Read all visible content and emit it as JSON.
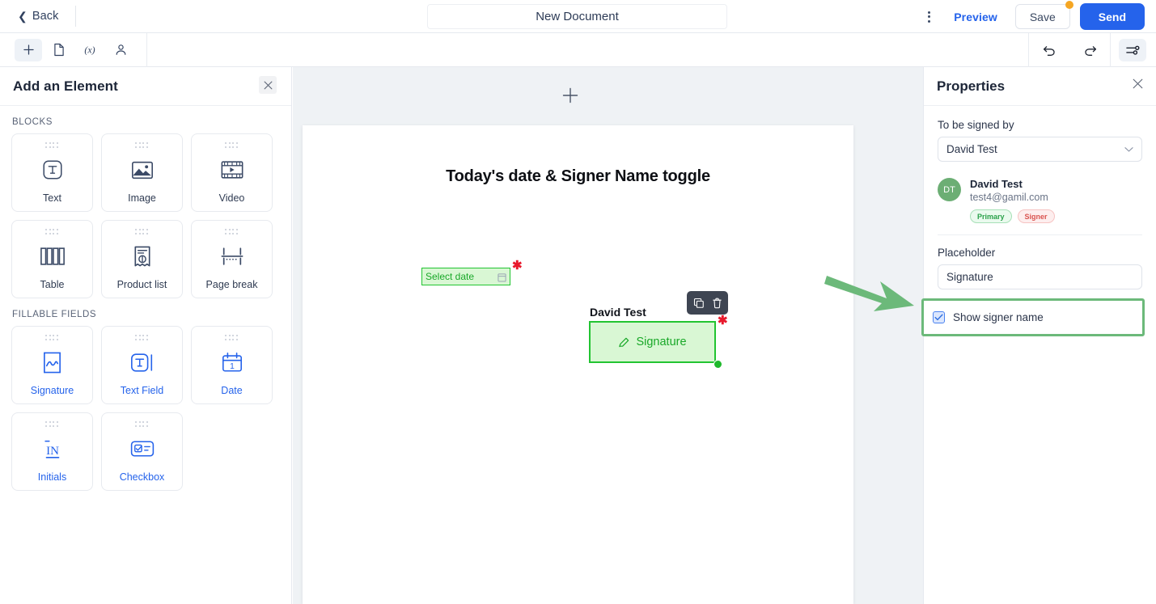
{
  "header": {
    "back_label": "Back",
    "document_title": "New Document",
    "document_title_placeholder": "Document name",
    "kebab_icon": "more-vertical-icon",
    "preview_label": "Preview",
    "save_label": "Save",
    "send_label": "Send",
    "save_badge": true
  },
  "toolbar": {
    "tools": [
      {
        "name": "add-element",
        "icon": "plus-icon",
        "active": true
      },
      {
        "name": "pages",
        "icon": "document-icon",
        "active": false
      },
      {
        "name": "variables",
        "icon": "variable-icon",
        "active": false
      },
      {
        "name": "recipients",
        "icon": "person-icon",
        "active": false
      }
    ],
    "undo_icon": "undo-icon",
    "redo_icon": "redo-icon",
    "settings_icon": "sliders-icon"
  },
  "left_panel": {
    "title": "Add an Element",
    "close_icon": "close-icon",
    "sections": [
      {
        "label": "BLOCKS",
        "items": [
          {
            "label": "Text",
            "icon": "text-block-icon",
            "accent": "dark"
          },
          {
            "label": "Image",
            "icon": "image-icon",
            "accent": "dark"
          },
          {
            "label": "Video",
            "icon": "video-icon",
            "accent": "dark"
          },
          {
            "label": "Table",
            "icon": "table-icon",
            "accent": "dark"
          },
          {
            "label": "Product list",
            "icon": "receipt-icon",
            "accent": "dark"
          },
          {
            "label": "Page break",
            "icon": "page-break-icon",
            "accent": "dark"
          }
        ]
      },
      {
        "label": "FILLABLE FIELDS",
        "items": [
          {
            "label": "Signature",
            "icon": "signature-icon",
            "accent": "blue"
          },
          {
            "label": "Text Field",
            "icon": "text-field-icon",
            "accent": "blue"
          },
          {
            "label": "Date",
            "icon": "calendar-icon",
            "accent": "blue"
          },
          {
            "label": "Initials",
            "icon": "initials-icon",
            "accent": "blue"
          },
          {
            "label": "Checkbox",
            "icon": "checkbox-field-icon",
            "accent": "blue"
          }
        ]
      }
    ]
  },
  "canvas": {
    "add_page_icon": "plus-icon",
    "page_menu_icon": "more-horizontal-icon",
    "page": {
      "heading": "Today's date & Signer Name toggle",
      "date_field": {
        "placeholder": "Select date",
        "icon": "calendar-icon",
        "required_marker": "✱"
      },
      "signature_field": {
        "signer_label": "David Test",
        "placeholder": "Signature",
        "icon": "pen-icon",
        "required_marker": "✱",
        "toolbar": {
          "duplicate_icon": "copy-icon",
          "delete_icon": "trash-icon"
        }
      }
    }
  },
  "right_panel": {
    "title": "Properties",
    "close_icon": "close-icon",
    "signed_by_label": "To be signed by",
    "signed_by_value": "David Test",
    "dropdown_icon": "chevron-down-icon",
    "signer": {
      "initials": "DT",
      "name": "David Test",
      "email": "test4@gamil.com",
      "badges": [
        "Primary",
        "Signer"
      ]
    },
    "placeholder_label": "Placeholder",
    "placeholder_value": "Signature",
    "placeholder_hint": "Signature",
    "show_signer_name_label": "Show signer name",
    "show_signer_name_checked": true
  },
  "annotation": {
    "arrow_color": "#6cb97a",
    "highlight_color": "#6cb97a"
  }
}
